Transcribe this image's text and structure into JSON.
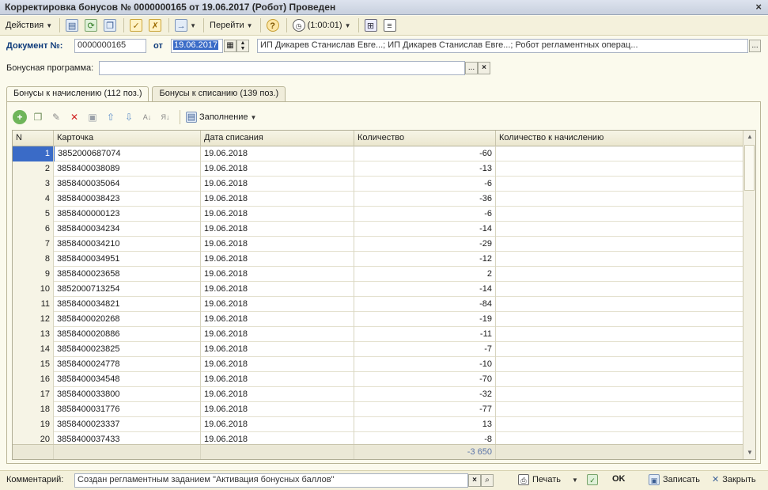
{
  "window": {
    "title": "Корректировка бонусов № 0000000165 от 19.06.2017 (Робот) Проведен",
    "close": "×"
  },
  "toolbar": {
    "actions_label": "Действия",
    "goto_label": "Перейти",
    "help": "?",
    "timer_label": "(1:00:01)"
  },
  "document": {
    "label": "Документ №:",
    "number": "0000000165",
    "from_label": "от",
    "date": "19.06.2017",
    "responsible": "ИП Дикарев Станислав Евге...; ИП Дикарев Станислав Евге...; Робот регламентных операц...",
    "ellipsis": "..."
  },
  "program": {
    "label": "Бонусная программа:",
    "value": "",
    "ellipsis": "...",
    "clear": "×"
  },
  "tabs": [
    {
      "label": "Бонусы к начислению (112 поз.)"
    },
    {
      "label": "Бонусы к списанию (139 поз.)"
    }
  ],
  "grid_toolbar": {
    "fill_label": "Заполнение"
  },
  "grid": {
    "columns": [
      "N",
      "Карточка",
      "Дата списания",
      "Количество",
      "Количество к начислению"
    ],
    "rows": [
      {
        "n": "1",
        "card": "3852000687074",
        "date": "19.06.2018",
        "qty": "-60",
        "acc": ""
      },
      {
        "n": "2",
        "card": "3858400038089",
        "date": "19.06.2018",
        "qty": "-13",
        "acc": ""
      },
      {
        "n": "3",
        "card": "3858400035064",
        "date": "19.06.2018",
        "qty": "-6",
        "acc": ""
      },
      {
        "n": "4",
        "card": "3858400038423",
        "date": "19.06.2018",
        "qty": "-36",
        "acc": ""
      },
      {
        "n": "5",
        "card": "3858400000123",
        "date": "19.06.2018",
        "qty": "-6",
        "acc": ""
      },
      {
        "n": "6",
        "card": "3858400034234",
        "date": "19.06.2018",
        "qty": "-14",
        "acc": ""
      },
      {
        "n": "7",
        "card": "3858400034210",
        "date": "19.06.2018",
        "qty": "-29",
        "acc": ""
      },
      {
        "n": "8",
        "card": "3858400034951",
        "date": "19.06.2018",
        "qty": "-12",
        "acc": ""
      },
      {
        "n": "9",
        "card": "3858400023658",
        "date": "19.06.2018",
        "qty": "2",
        "acc": ""
      },
      {
        "n": "10",
        "card": "3852000713254",
        "date": "19.06.2018",
        "qty": "-14",
        "acc": ""
      },
      {
        "n": "11",
        "card": "3858400034821",
        "date": "19.06.2018",
        "qty": "-84",
        "acc": ""
      },
      {
        "n": "12",
        "card": "3858400020268",
        "date": "19.06.2018",
        "qty": "-19",
        "acc": ""
      },
      {
        "n": "13",
        "card": "3858400020886",
        "date": "19.06.2018",
        "qty": "-11",
        "acc": ""
      },
      {
        "n": "14",
        "card": "3858400023825",
        "date": "19.06.2018",
        "qty": "-7",
        "acc": ""
      },
      {
        "n": "15",
        "card": "3858400024778",
        "date": "19.06.2018",
        "qty": "-10",
        "acc": ""
      },
      {
        "n": "16",
        "card": "3858400034548",
        "date": "19.06.2018",
        "qty": "-70",
        "acc": ""
      },
      {
        "n": "17",
        "card": "3858400033800",
        "date": "19.06.2018",
        "qty": "-32",
        "acc": ""
      },
      {
        "n": "18",
        "card": "3858400031776",
        "date": "19.06.2018",
        "qty": "-77",
        "acc": ""
      },
      {
        "n": "19",
        "card": "3858400023337",
        "date": "19.06.2018",
        "qty": "13",
        "acc": ""
      },
      {
        "n": "20",
        "card": "3858400037433",
        "date": "19.06.2018",
        "qty": "-8",
        "acc": ""
      }
    ],
    "total_qty": "-3 650"
  },
  "bottom": {
    "comment_label": "Комментарий:",
    "comment_value": "Создан регламентным заданием \"Активация бонусных баллов\"",
    "print_label": "Печать",
    "ok_label": "OK",
    "save_label": "Записать",
    "close_label": "Закрыть"
  },
  "colors": {
    "background": "#fbfaed",
    "selection": "#3a6bc7",
    "label_blue": "#0d3a7a"
  }
}
